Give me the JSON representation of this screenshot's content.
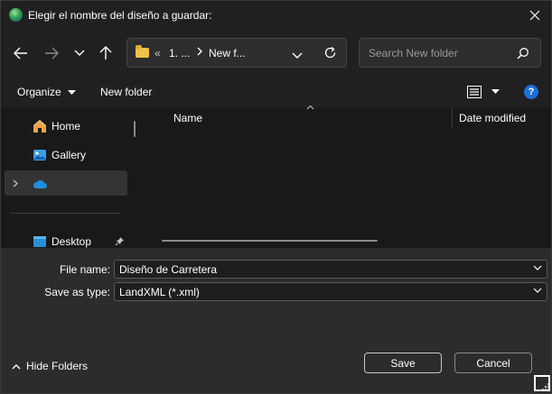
{
  "window": {
    "title": "Elegir el nombre del diseño a guardar:"
  },
  "address": {
    "overflow": "«",
    "crumbs": [
      "1. ...",
      "New f..."
    ]
  },
  "search": {
    "placeholder": "Search New folder"
  },
  "toolbar": {
    "organize_label": "Organize",
    "new_folder_label": "New folder"
  },
  "sidebar": {
    "items": [
      {
        "label": "Home",
        "icon": "home-icon"
      },
      {
        "label": "Gallery",
        "icon": "gallery-icon"
      },
      {
        "label": "",
        "icon": "onedrive-icon",
        "selected": true
      },
      {
        "label": "Desktop",
        "icon": "desktop-icon",
        "pinned": true
      }
    ]
  },
  "filelist": {
    "columns": [
      "Name",
      "Date modified"
    ]
  },
  "form": {
    "filename_label": "File name:",
    "filename_value": "Diseño de Carretera",
    "type_label": "Save as type:",
    "type_value": "LandXML (*.xml)"
  },
  "footer": {
    "hide_folders_label": "Hide Folders",
    "save_label": "Save",
    "cancel_label": "Cancel"
  },
  "colors": {
    "background": "#202020",
    "accent": "#1f6fd6",
    "folder": "#f0c24b"
  }
}
